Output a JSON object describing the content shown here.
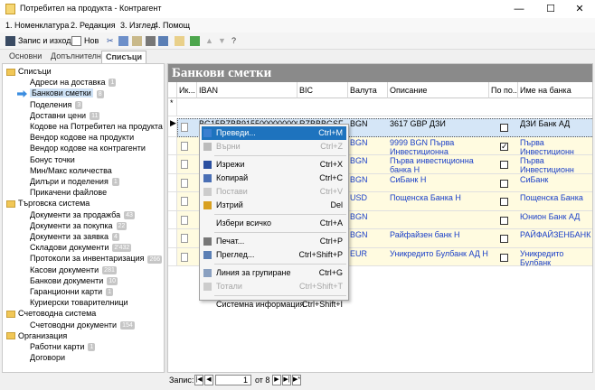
{
  "window": {
    "title": "Потребител на продукта - Контрагент",
    "minimize": "—",
    "maximize": "☐",
    "close": "✕"
  },
  "menu": [
    "1. Номенклатура",
    "2. Редакция",
    "3. Изглед",
    "4. Помощ"
  ],
  "toolbar": {
    "save_exit": "Запис и изход",
    "new": "Нов"
  },
  "tabs": [
    "Основни",
    "Допълнителни",
    "Списъци"
  ],
  "tree": [
    {
      "label": "Списъци",
      "folder": true
    },
    {
      "label": "Адреси на доставка",
      "badge": "1"
    },
    {
      "label": "Банкови сметки",
      "badge": "8",
      "selected": true
    },
    {
      "label": "Поделения",
      "badge": "3"
    },
    {
      "label": "Доставни цени",
      "badge": "11"
    },
    {
      "label": "Кодове на Потребител на продукта в ИС"
    },
    {
      "label": "Вендор кодове на продукти"
    },
    {
      "label": "Вендор кодове на контрагенти"
    },
    {
      "label": "Бонус точки"
    },
    {
      "label": "Мин/Макс количества"
    },
    {
      "label": "Дилъри и поделения",
      "badge": "1"
    },
    {
      "label": "Прикачени файлове"
    },
    {
      "label": "Търговска система",
      "folder": true
    },
    {
      "label": "Документи за продажба",
      "badge": "43"
    },
    {
      "label": "Документи за покупка",
      "badge": "22"
    },
    {
      "label": "Документи за заявка",
      "badge": "4"
    },
    {
      "label": "Складови документи",
      "badge": "2'432"
    },
    {
      "label": "Протоколи за инвентаризация",
      "badge": "266"
    },
    {
      "label": "Касови документи",
      "badge": "281"
    },
    {
      "label": "Банкови документи",
      "badge": "10"
    },
    {
      "label": "Гаранционни карти",
      "badge": "1"
    },
    {
      "label": "Куриерски товарителници"
    },
    {
      "label": "Счетоводна система",
      "folder": true
    },
    {
      "label": "Счетоводни документи",
      "badge": "154"
    },
    {
      "label": "Организация",
      "folder": true
    },
    {
      "label": "Работни карти",
      "badge": "1"
    },
    {
      "label": "Договори"
    }
  ],
  "main": {
    "title": "Банкови сметки",
    "columns": [
      "Ик...",
      "IBAN",
      "BIC",
      "Валута",
      "Описание",
      "По по...",
      "Име на банка"
    ],
    "rows": [
      {
        "iban": "BG15RZBB91550000000000",
        "bic": "RZBBBGSF",
        "currency": "BGN",
        "description": "3617 GBP ДЗИ",
        "checked": false,
        "bank": "ДЗИ Банк АД",
        "blue": false
      },
      {
        "iban": "",
        "bic": "",
        "currency": "BGN",
        "description": "9999 BGN Първа Инвестиционна",
        "checked": true,
        "bank": "Първа Инвестиционн",
        "blue": true
      },
      {
        "iban": "",
        "bic": "",
        "currency": "BGN",
        "description": "Първа инвестиционна банка Н",
        "checked": false,
        "bank": "Първа Инвестиционн",
        "blue": true
      },
      {
        "iban": "",
        "bic": "",
        "currency": "BGN",
        "description": "СиБанк Н",
        "checked": false,
        "bank": "СиБанк",
        "blue": true
      },
      {
        "iban": "",
        "bic": "",
        "currency": "USD",
        "description": "Пощенска Банка Н",
        "checked": false,
        "bank": "Пощенска Банка",
        "blue": true
      },
      {
        "iban": "",
        "bic": "",
        "currency": "BGN",
        "description": "",
        "checked": false,
        "bank": "Юнион Банк АД",
        "blue": true
      },
      {
        "iban": "",
        "bic": "",
        "currency": "BGN",
        "description": "Райфайзен банк Н",
        "checked": false,
        "bank": "РАЙФАЙЗЕНБАНК",
        "blue": true
      },
      {
        "iban": "",
        "bic": "",
        "currency": "EUR",
        "description": "Уникредито Булбанк АД Н",
        "checked": false,
        "bank": "Уникредито Булбанк",
        "blue": true
      }
    ],
    "header_currency_row1": "GBP"
  },
  "context_menu": [
    {
      "label": "Преведи...",
      "shortcut": "Ctrl+M",
      "highlight": true
    },
    {
      "label": "Върни",
      "shortcut": "Ctrl+Z",
      "disabled": true
    },
    {
      "sep": true
    },
    {
      "label": "Изрежи",
      "shortcut": "Ctrl+X"
    },
    {
      "label": "Копирай",
      "shortcut": "Ctrl+C"
    },
    {
      "label": "Постави",
      "shortcut": "Ctrl+V",
      "disabled": true
    },
    {
      "label": "Изтрий",
      "shortcut": "Del"
    },
    {
      "sep": true
    },
    {
      "label": "Избери всичко",
      "shortcut": "Ctrl+A"
    },
    {
      "sep": true
    },
    {
      "label": "Печат...",
      "shortcut": "Ctrl+P"
    },
    {
      "label": "Преглед...",
      "shortcut": "Ctrl+Shift+P"
    },
    {
      "sep": true
    },
    {
      "label": "Линия за групиране",
      "shortcut": "Ctrl+G"
    },
    {
      "label": "Тотали",
      "shortcut": "Ctrl+Shift+T",
      "disabled": true
    },
    {
      "sep": true
    },
    {
      "label": "Системна информация",
      "shortcut": "Ctrl+Shift+I"
    }
  ],
  "status": {
    "record_label": "Запис:",
    "current": "1",
    "of_label": "от 8"
  },
  "colors": {
    "highlight": "#1e73be",
    "banner": "#8a8a8a",
    "link_blue": "#1a3fc8",
    "row_yellow": "#fffbe0"
  }
}
